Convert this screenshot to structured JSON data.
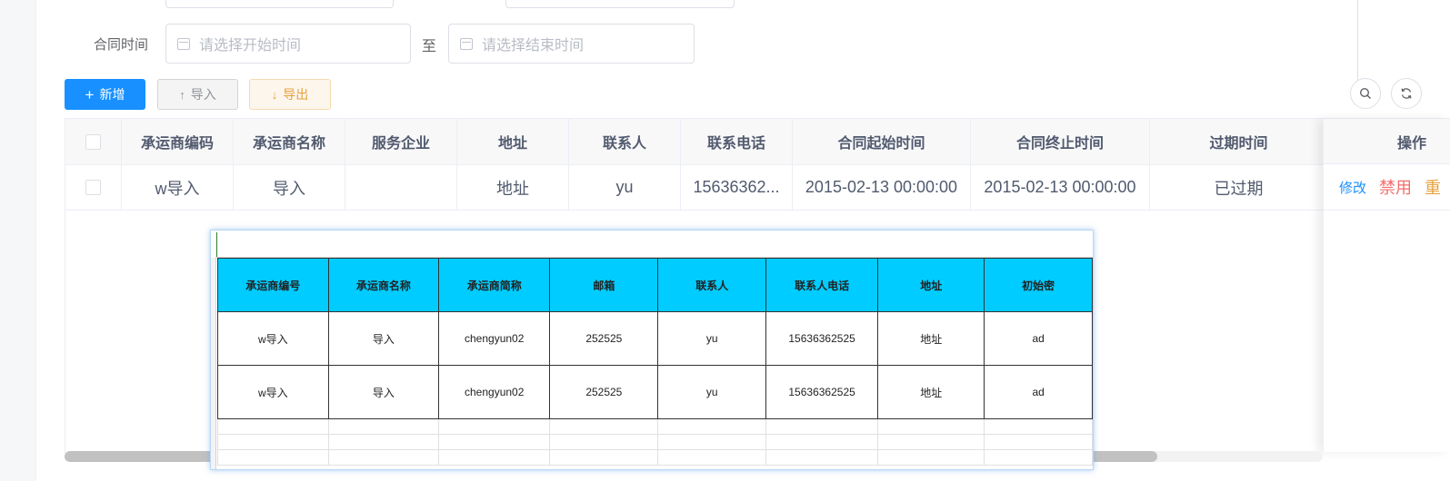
{
  "filter": {
    "contract_time_label": "合同时间",
    "start_placeholder": "请选择开始时间",
    "range_separator": "至",
    "end_placeholder": "请选择结束时间"
  },
  "toolbar": {
    "add_icon": "+",
    "add_label": "新增",
    "import_icon": "↑",
    "import_label": "导入",
    "export_icon": "↓",
    "export_label": "导出"
  },
  "table": {
    "headers": [
      "承运商编码",
      "承运商名称",
      "服务企业",
      "地址",
      "联系人",
      "联系电话",
      "合同起始时间",
      "合同终止时间",
      "过期时间",
      "操作"
    ],
    "rows": [
      {
        "code": "w导入",
        "name": "导入",
        "service_company": "",
        "address": "地址",
        "contact": "yu",
        "phone": "15636362...",
        "contract_start": "2015-02-13 00:00:00",
        "contract_end": "2015-02-13 00:00:00",
        "expire": "已过期",
        "actions": {
          "edit": "修改",
          "disable": "禁用",
          "more": "重"
        }
      }
    ]
  },
  "spreadsheet": {
    "headers": [
      "承运商编号",
      "承运商名称",
      "承运商简称",
      "邮箱",
      "联系人",
      "联系人电话",
      "地址",
      "初始密"
    ],
    "rows": [
      [
        "w导入",
        "导入",
        "chengyun02",
        "252525",
        "yu",
        "15636362525",
        "地址",
        "ad"
      ],
      [
        "w导入",
        "导入",
        "chengyun02",
        "252525",
        "yu",
        "15636362525",
        "地址",
        "ad"
      ]
    ]
  },
  "colors": {
    "primary": "#1890ff",
    "warning": "#e6a23c",
    "danger": "#f56c6c",
    "sheet_header": "#00ccff"
  },
  "icons": {
    "calendar": "calendar-icon",
    "search": "search-icon",
    "refresh": "refresh-icon"
  }
}
